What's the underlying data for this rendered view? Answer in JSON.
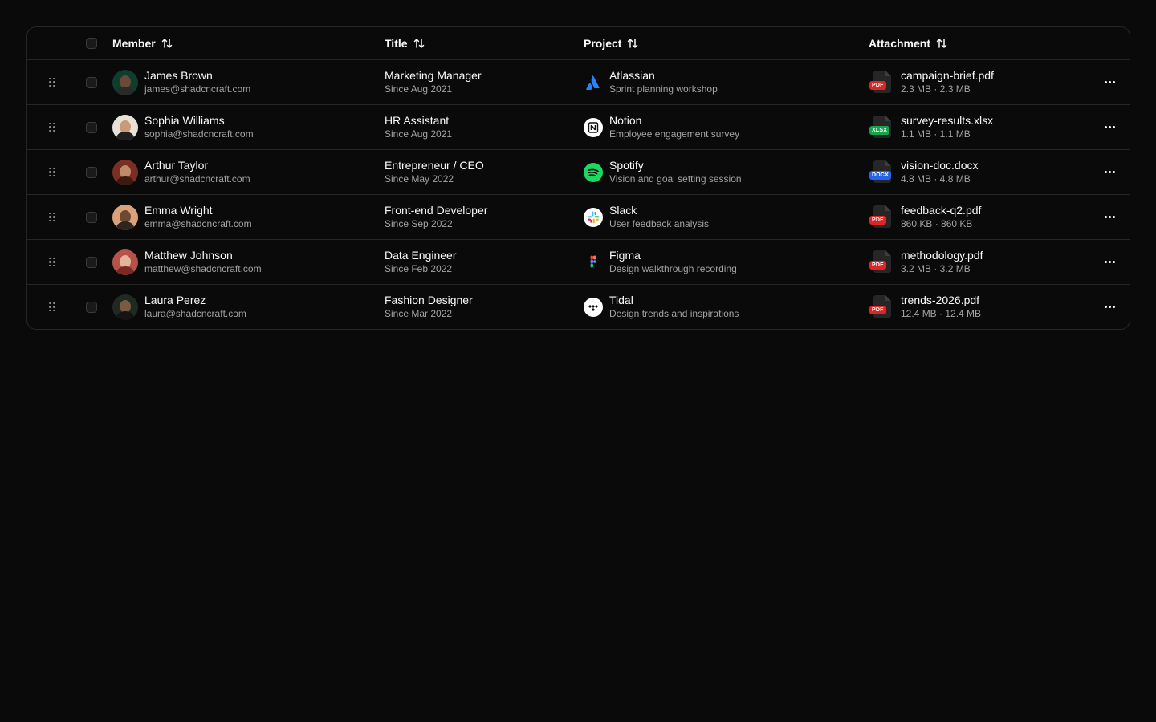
{
  "headers": {
    "member": "Member",
    "title": "Title",
    "project": "Project",
    "attachment": "Attachment"
  },
  "rows": [
    {
      "name": "James Brown",
      "email": "james@shadcncraft.com",
      "title": "Marketing Manager",
      "since": "Since Aug 2021",
      "project": "Atlassian",
      "project_desc": "Sprint planning workshop",
      "project_icon": "atlassian-icon",
      "file": "campaign-brief.pdf",
      "file_size": "2.3 MB · 2.3 MB",
      "file_type": "PDF",
      "file_color": "#dc2626",
      "avatar_bg": "#0f3d2e",
      "avatar_face": "#6b4a35",
      "avatar_body": "#2a2a2a"
    },
    {
      "name": "Sophia Williams",
      "email": "sophia@shadcncraft.com",
      "title": "HR Assistant",
      "since": "Since Aug 2021",
      "project": "Notion",
      "project_desc": "Employee engagement survey",
      "project_icon": "notion-icon",
      "file": "survey-results.xlsx",
      "file_size": "1.1 MB · 1.1 MB",
      "file_type": "XLSX",
      "file_color": "#16a34a",
      "avatar_bg": "#e8e2d6",
      "avatar_face": "#c99a74",
      "avatar_body": "#1f1f1f"
    },
    {
      "name": "Arthur Taylor",
      "email": "arthur@shadcncraft.com",
      "title": "Entrepreneur / CEO",
      "since": "Since May 2022",
      "project": "Spotify",
      "project_desc": "Vision and goal setting session",
      "project_icon": "spotify-icon",
      "file": "vision-doc.docx",
      "file_size": "4.8 MB · 4.8 MB",
      "file_type": "DOCX",
      "file_color": "#2563eb",
      "avatar_bg": "#7a2e24",
      "avatar_face": "#c08a6a",
      "avatar_body": "#3b1a12"
    },
    {
      "name": "Emma Wright",
      "email": "emma@shadcncraft.com",
      "title": "Front-end Developer",
      "since": "Since Sep 2022",
      "project": "Slack",
      "project_desc": "User feedback analysis",
      "project_icon": "slack-icon",
      "file": "feedback-q2.pdf",
      "file_size": "860 KB · 860 KB",
      "file_type": "PDF",
      "file_color": "#dc2626",
      "avatar_bg": "#d9a27a",
      "avatar_face": "#6e4a34",
      "avatar_body": "#2e2520"
    },
    {
      "name": "Matthew Johnson",
      "email": "matthew@shadcncraft.com",
      "title": "Data Engineer",
      "since": "Since Feb 2022",
      "project": "Figma",
      "project_desc": "Design walkthrough recording",
      "project_icon": "figma-icon",
      "file": "methodology.pdf",
      "file_size": "3.2 MB · 3.2 MB",
      "file_type": "PDF",
      "file_color": "#dc2626",
      "avatar_bg": "#b5524a",
      "avatar_face": "#e2b59a",
      "avatar_body": "#7a2a24"
    },
    {
      "name": "Laura Perez",
      "email": "laura@shadcncraft.com",
      "title": "Fashion Designer",
      "since": "Since Mar 2022",
      "project": "Tidal",
      "project_desc": "Design trends and inspirations",
      "project_icon": "tidal-icon",
      "file": "trends-2026.pdf",
      "file_size": "12.4 MB · 12.4 MB",
      "file_type": "PDF",
      "file_color": "#dc2626",
      "avatar_bg": "#1f2a22",
      "avatar_face": "#7a5a44",
      "avatar_body": "#141414"
    }
  ]
}
